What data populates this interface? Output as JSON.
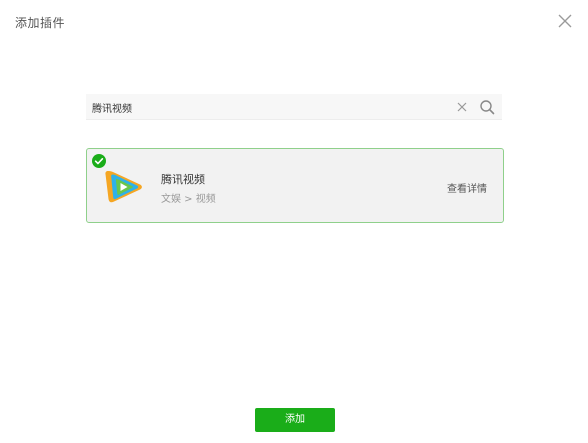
{
  "dialog": {
    "title": "添加插件"
  },
  "search": {
    "value": "腾讯视频"
  },
  "result": {
    "name": "腾讯视频",
    "category": "文娱 > 视频",
    "detail_label": "查看详情",
    "selected": true,
    "logo": "tencent-video-logo"
  },
  "footer": {
    "add_label": "添加"
  },
  "colors": {
    "accent": "#1aad19",
    "card_border": "#8fd08b",
    "card_bg": "#f2f2f2"
  }
}
